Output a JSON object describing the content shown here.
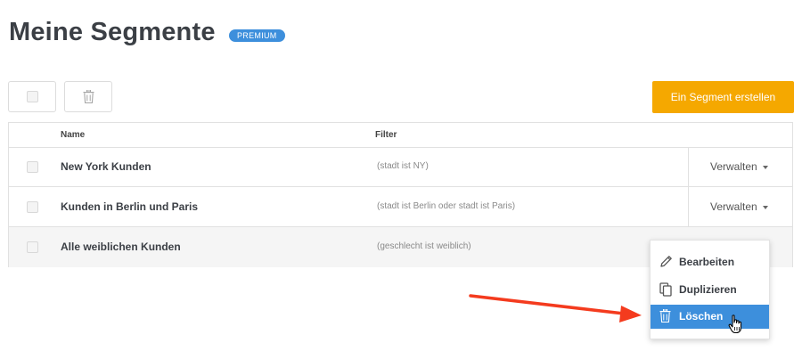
{
  "header": {
    "title": "Meine Segmente",
    "badge": "PREMIUM"
  },
  "toolbar": {
    "select_all_icon": "checkbox-icon",
    "delete_icon": "trash-icon"
  },
  "create_button": {
    "label": "Ein Segment erstellen",
    "color": "#f5a800"
  },
  "table": {
    "columns": {
      "name": "Name",
      "filter": "Filter"
    },
    "rows": [
      {
        "name": "New York Kunden",
        "filter": "(stadt ist NY)",
        "manage": "Verwalten"
      },
      {
        "name": "Kunden in Berlin und Paris",
        "filter": "(stadt ist Berlin oder stadt ist Paris)",
        "manage": "Verwalten"
      },
      {
        "name": "Alle weiblichen Kunden",
        "filter": "(geschlecht ist weiblich)"
      }
    ]
  },
  "dropdown": {
    "items": [
      {
        "label": "Bearbeiten",
        "icon": "pencil-icon"
      },
      {
        "label": "Duplizieren",
        "icon": "copy-icon"
      },
      {
        "label": "Löschen",
        "icon": "trash-icon",
        "highlighted": true
      }
    ],
    "highlight_color": "#3d8fdc"
  },
  "annotation": {
    "arrow_color": "#f43b1e",
    "cursor_icon": "hand-pointer-icon"
  }
}
